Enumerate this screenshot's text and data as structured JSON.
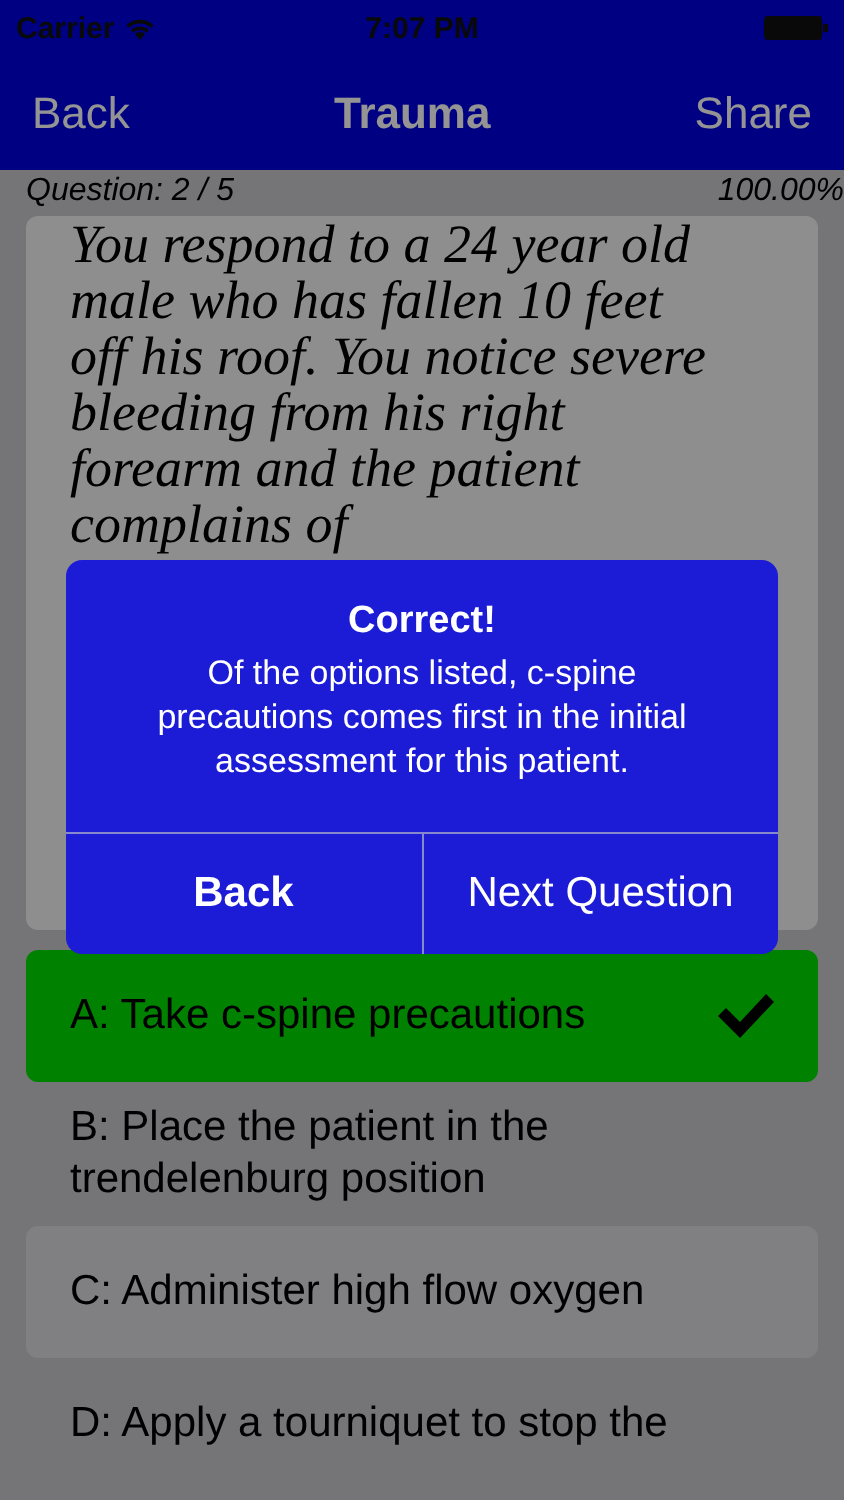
{
  "status_bar": {
    "carrier": "Carrier",
    "time": "7:07 PM"
  },
  "nav": {
    "back": "Back",
    "title": "Trauma",
    "share": "Share"
  },
  "progress": {
    "question": "Question: 2 / 5",
    "score": "100.00%"
  },
  "question": "You respond to a 24 year old male who has fallen 10 feet off his roof. You notice severe bleeding from his right forearm and the patient complains of",
  "answers": [
    {
      "text": "A: Take c-spine precautions",
      "correct": true
    },
    {
      "text": "B: Place the patient in the trendelenburg position",
      "correct": false
    },
    {
      "text": "C: Administer high flow oxygen",
      "correct": false
    },
    {
      "text": "D: Apply a tourniquet to stop the",
      "correct": false
    }
  ],
  "alert": {
    "title": "Correct!",
    "message": "Of the options listed, c-spine precautions comes first in the initial assessment for this patient.",
    "buttons": [
      "Back",
      "Next Question"
    ]
  }
}
